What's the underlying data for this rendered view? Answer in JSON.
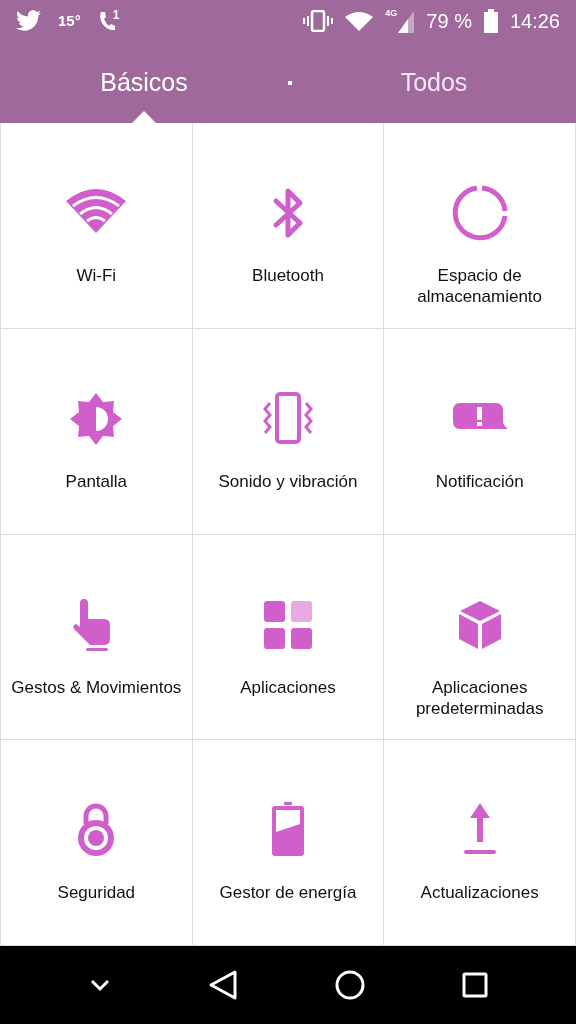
{
  "status_bar": {
    "temperature": "15°",
    "call_badge": "1",
    "network_type": "4G",
    "battery_text": "79 %",
    "time": "14:26"
  },
  "tabs": [
    {
      "label": "Básicos",
      "selected": true
    },
    {
      "label": "Todos",
      "selected": false
    }
  ],
  "grid": [
    {
      "label": "Wi-Fi"
    },
    {
      "label": "Bluetooth"
    },
    {
      "label": "Espacio de almacenamiento"
    },
    {
      "label": "Pantalla"
    },
    {
      "label": "Sonido y vibración"
    },
    {
      "label": "Notificación"
    },
    {
      "label": "Gestos & Movimientos"
    },
    {
      "label": "Aplicaciones"
    },
    {
      "label": "Aplicaciones predeterminadas"
    },
    {
      "label": "Seguridad"
    },
    {
      "label": "Gestor de energía"
    },
    {
      "label": "Actualizaciones"
    }
  ]
}
